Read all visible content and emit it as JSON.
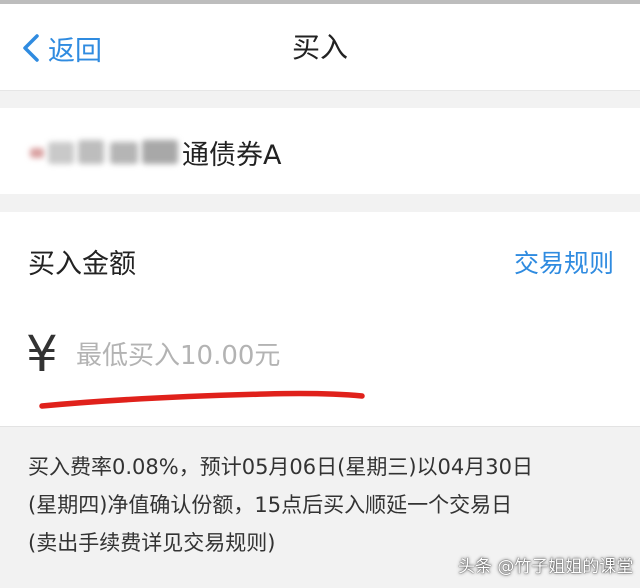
{
  "nav": {
    "back_label": "返回",
    "title": "买入"
  },
  "fund": {
    "name_visible": "通债券A"
  },
  "purchase": {
    "amount_label": "买入金额",
    "rules_link": "交易规则",
    "currency_symbol": "¥",
    "amount_value": "",
    "amount_placeholder": "最低买入10.00元"
  },
  "fee_note": {
    "lines": [
      "买入费率0.08%，预计05月06日(星期三)以04月30日",
      "(星期四)净值确认份额，15点后买入顺延一个交易日",
      "(卖出手续费详见交易规则)"
    ]
  },
  "watermark": {
    "text": "头条 @竹子姐姐的课堂"
  },
  "colors": {
    "accent": "#2f8be0",
    "annotation_red": "#e0211b",
    "placeholder": "#b3b3b3",
    "background": "#f2f2f2"
  }
}
